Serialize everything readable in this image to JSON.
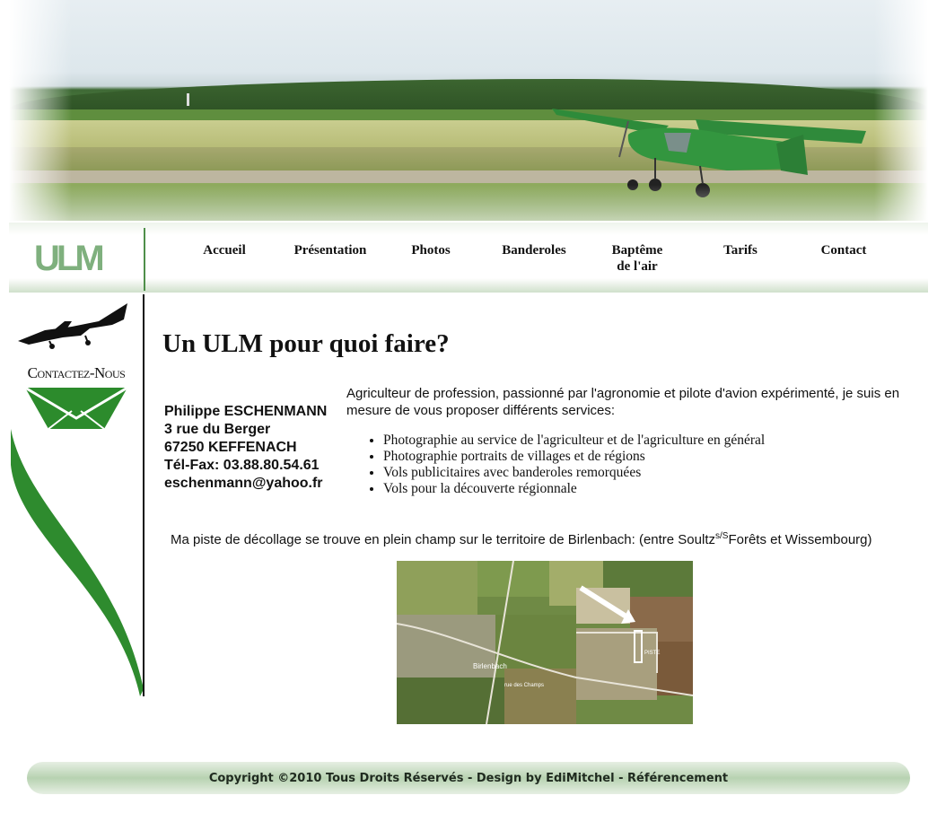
{
  "header": {
    "logo": "ULM"
  },
  "nav": {
    "items": [
      {
        "label": "Accueil"
      },
      {
        "label": "Présentation"
      },
      {
        "label": "Photos"
      },
      {
        "label": "Banderoles"
      },
      {
        "label": "Baptême de l'air",
        "line1": "Baptême",
        "line2": "de l'air"
      },
      {
        "label": "Tarifs"
      },
      {
        "label": "Contact"
      }
    ]
  },
  "sidebar": {
    "contact_label": "Contactez-Nous",
    "contact_icon": "envelope-icon",
    "plane_icon": "airplane-silhouette-icon"
  },
  "main": {
    "title": "Un ULM pour quoi faire?",
    "contact": {
      "name": "Philippe ESCHENMANN",
      "street": "3 rue du Berger",
      "city": "67250 KEFFENACH",
      "phone": "Tél-Fax: 03.88.80.54.61",
      "email": "eschenmann@yahoo.fr"
    },
    "intro": "Agriculteur de profession, passionné par l'agronomie et pilote d'avion expérimenté, je suis en mesure de vous proposer différents services:",
    "services": [
      "Photographie au service de l'agriculteur et de l'agriculture en général",
      "Photographie portraits de villages et de régions",
      "Vols publicitaires avec banderoles remorquées",
      "Vols pour la découverte régionnale"
    ],
    "piste": {
      "before": "Ma piste de décollage se trouve en plein champ sur le territoire de Birlenbach: (entre Soultz",
      "sup": "s/S",
      "after": "Forêts et Wissembourg)"
    },
    "map": {
      "village_label": "Birlenbach",
      "road_label": "rue des Champs",
      "marker_label": "PISTE"
    }
  },
  "footer": {
    "text": "Copyright ©2010 Tous Droits Réservés - Design by EdiMitchel - Référencement"
  },
  "colors": {
    "accent_green": "#2e8b2e",
    "logo_green": "#7fb07e",
    "text": "#111111"
  }
}
